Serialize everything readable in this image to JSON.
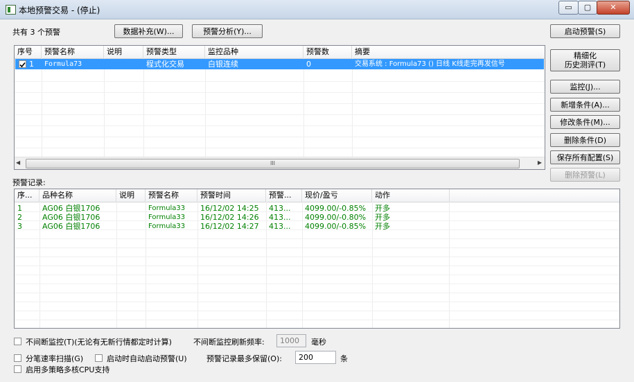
{
  "window": {
    "title": "本地预警交易 - (停止)",
    "min_glyph": "▭",
    "max_glyph": "▢",
    "close_glyph": "✕"
  },
  "top": {
    "count_label": "共有 3 个预警",
    "btn_data_fill": "数据补充(W)...",
    "btn_alert_analysis": "预警分析(Y)..."
  },
  "right_buttons": {
    "start_alert": "启动预警(S)",
    "refine_line1": "精细化",
    "refine_line2": "历史测评(T)",
    "monitor": "监控(J)...",
    "add_condition": "新增条件(A)...",
    "modify_condition": "修改条件(M)...",
    "delete_condition": "删除条件(D)",
    "save_all": "保存所有配置(S)",
    "delete_alert": "删除预警(L)"
  },
  "alert_table": {
    "columns": [
      "序号",
      "预警名称",
      "说明",
      "预警类型",
      "监控品种",
      "预警数",
      "摘要"
    ],
    "rows": [
      {
        "checked": true,
        "index": "1",
        "name": "Formula73",
        "desc": "",
        "type": "程式化交易",
        "symbol": "白银连续",
        "count": "0",
        "summary": "交易系统 : Formula73 () 日线 K线走完再发信号"
      }
    ],
    "scroll_glyph": "III"
  },
  "records": {
    "label": "预警记录:",
    "columns": [
      "序...",
      "品种名称",
      "说明",
      "预警名称",
      "预警时间",
      "预警...",
      "现价/盈亏",
      "动作"
    ],
    "rows": [
      {
        "index": "1",
        "symbol": "AG06 白银1706",
        "desc": "",
        "name": "Formula33",
        "time": "16/12/02 14:25",
        "price": "413...",
        "pnl": "4099.00/-0.85%",
        "action": "开多"
      },
      {
        "index": "2",
        "symbol": "AG06 白银1706",
        "desc": "",
        "name": "Formula33",
        "time": "16/12/02 14:26",
        "price": "413...",
        "pnl": "4099.00/-0.80%",
        "action": "开多"
      },
      {
        "index": "3",
        "symbol": "AG06 白银1706",
        "desc": "",
        "name": "Formula33",
        "time": "16/12/02 14:27",
        "price": "413...",
        "pnl": "4099.00/-0.85%",
        "action": "开多"
      }
    ]
  },
  "options": {
    "continuous_monitor": "不间断监控(T)(无论有无新行情都定时计算)",
    "refresh_freq_label": "不间断监控刷新频率:",
    "refresh_freq_value": "1000",
    "refresh_freq_unit": "毫秒",
    "tick_scan": "分笔速率扫描(G)",
    "auto_start": "启动时自动启动预警(U)",
    "max_records_label": "预警记录最多保留(O):",
    "max_records_value": "200",
    "max_records_unit": "条",
    "multi_cpu": "启用多策略多核CPU支持"
  }
}
